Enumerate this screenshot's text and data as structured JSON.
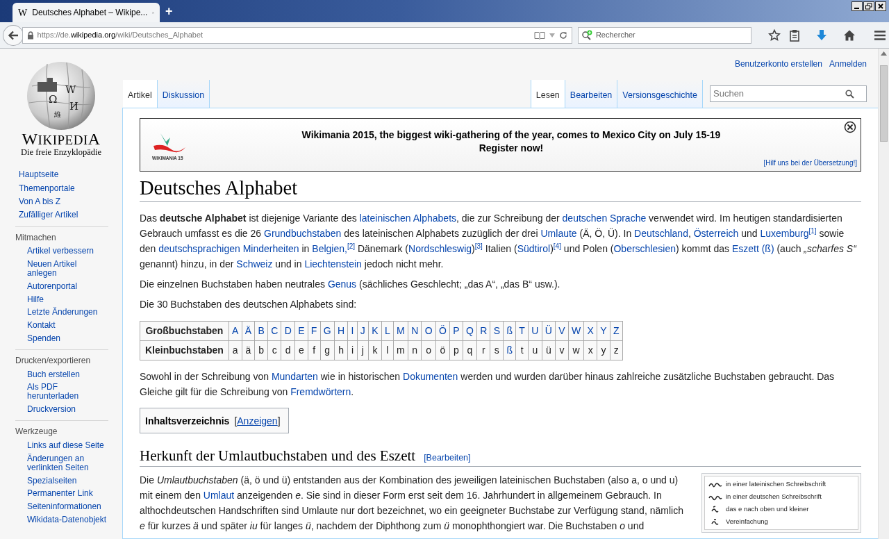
{
  "browser": {
    "favicon": "W",
    "tab_title": "Deutsches Alphabet – Wikipe...",
    "new_tab": "+",
    "url": {
      "prefix": "https://de.",
      "host": "wikipedia.org",
      "path": "/wiki/Deutsches_Alphabet"
    },
    "search_placeholder": "Rechercher"
  },
  "personal_links": [
    "Benutzerkonto erstellen",
    "Anmelden"
  ],
  "logo": {
    "glyphs": [
      "Ω",
      "W",
      "И",
      "維"
    ],
    "wordmark": "WIKIPEDIA",
    "tagline": "Die freie Enzyklopädie"
  },
  "sidebar": {
    "main": [
      "Hauptseite",
      "Themenportale",
      "Von A bis Z",
      "Zufälliger Artikel"
    ],
    "sections": [
      {
        "heading": "Mitmachen",
        "items": [
          "Artikel verbessern",
          "Neuen Artikel anlegen",
          "Autorenportal",
          "Hilfe",
          "Letzte Änderungen",
          "Kontakt",
          "Spenden"
        ]
      },
      {
        "heading": "Drucken/exportieren",
        "items": [
          "Buch erstellen",
          "Als PDF herunterladen",
          "Druckversion"
        ]
      },
      {
        "heading": "Werkzeuge",
        "items": [
          "Links auf diese Seite",
          "Änderungen an verlinkten Seiten",
          "Spezialseiten",
          "Permanenter Link",
          "Seiteninformationen",
          "Wikidata-Datenobjekt"
        ]
      }
    ]
  },
  "tabs_left": [
    {
      "label": "Artikel",
      "selected": true
    },
    {
      "label": "Diskussion",
      "selected": false
    }
  ],
  "tabs_right": [
    {
      "label": "Lesen",
      "selected": true
    },
    {
      "label": "Bearbeiten",
      "selected": false
    },
    {
      "label": "Versionsgeschichte",
      "selected": false
    }
  ],
  "search": {
    "placeholder": "Suchen"
  },
  "banner": {
    "logo_text": "WIKIMANIA 15",
    "lines": [
      "Wikimania 2015, the biggest wiki-gathering of the year, comes to Mexico City on July 15-19",
      "Register now!"
    ],
    "help_link": "[Hilf uns bei der Übersetzung!]"
  },
  "title": "Deutsches Alphabet",
  "intro": [
    [
      {
        "kind": "text",
        "text": "Das "
      },
      {
        "kind": "bold",
        "text": "deutsche Alphabet"
      },
      {
        "kind": "text",
        "text": " ist diejenige Variante des "
      },
      {
        "kind": "link",
        "text": "lateinischen Alphabets"
      },
      {
        "kind": "text",
        "text": ", die zur Schreibung der "
      },
      {
        "kind": "link",
        "text": "deutschen Sprache"
      },
      {
        "kind": "text",
        "text": " verwendet wird. Im heutigen standardisierten Gebrauch umfasst es die 26 "
      },
      {
        "kind": "link",
        "text": "Grundbuchstaben"
      },
      {
        "kind": "text",
        "text": " des lateinischen Alphabets zuzüglich der drei "
      },
      {
        "kind": "link",
        "text": "Umlaute"
      },
      {
        "kind": "text",
        "text": " (Ä, Ö, Ü). In "
      },
      {
        "kind": "link",
        "text": "Deutschland"
      },
      {
        "kind": "text",
        "text": ", "
      },
      {
        "kind": "link",
        "text": "Österreich"
      },
      {
        "kind": "text",
        "text": " und "
      },
      {
        "kind": "link",
        "text": "Luxemburg"
      },
      {
        "kind": "ref",
        "text": "[1]"
      },
      {
        "kind": "text",
        "text": " sowie den "
      },
      {
        "kind": "link",
        "text": "deutschsprachigen Minderheiten"
      },
      {
        "kind": "text",
        "text": " in "
      },
      {
        "kind": "link",
        "text": "Belgien,"
      },
      {
        "kind": "ref",
        "text": "[2]"
      },
      {
        "kind": "text",
        "text": " Dänemark ("
      },
      {
        "kind": "link",
        "text": "Nordschleswig"
      },
      {
        "kind": "text",
        "text": ")"
      },
      {
        "kind": "ref",
        "text": "[3]"
      },
      {
        "kind": "text",
        "text": " Italien ("
      },
      {
        "kind": "link",
        "text": "Südtirol"
      },
      {
        "kind": "text",
        "text": ")"
      },
      {
        "kind": "ref",
        "text": "[4]"
      },
      {
        "kind": "text",
        "text": " und Polen ("
      },
      {
        "kind": "link",
        "text": "Oberschlesien"
      },
      {
        "kind": "text",
        "text": ") kommt das "
      },
      {
        "kind": "link",
        "text": "Eszett (ß)"
      },
      {
        "kind": "text",
        "text": " (auch "
      },
      {
        "kind": "italic",
        "text": "„scharfes S“"
      },
      {
        "kind": "text",
        "text": " genannt) hinzu, in der "
      },
      {
        "kind": "link",
        "text": "Schweiz"
      },
      {
        "kind": "text",
        "text": " und in "
      },
      {
        "kind": "link",
        "text": "Liechtenstein"
      },
      {
        "kind": "text",
        "text": " jedoch nicht mehr."
      }
    ],
    [
      {
        "kind": "text",
        "text": "Die einzelnen Buchstaben haben neutrales "
      },
      {
        "kind": "link",
        "text": "Genus"
      },
      {
        "kind": "text",
        "text": " (sächliches Geschlecht; „das A“, „das B“ usw.)."
      }
    ],
    [
      {
        "kind": "text",
        "text": "Die 30 Buchstaben des deutschen Alphabets sind:"
      }
    ]
  ],
  "letter_table": [
    {
      "header": "Großbuchstaben",
      "cells": [
        {
          "text": "A",
          "link": true
        },
        {
          "text": "Ä",
          "link": true
        },
        {
          "text": "B",
          "link": true
        },
        {
          "text": "C",
          "link": true
        },
        {
          "text": "D",
          "link": true
        },
        {
          "text": "E",
          "link": true
        },
        {
          "text": "F",
          "link": true
        },
        {
          "text": "G",
          "link": true
        },
        {
          "text": "H",
          "link": true
        },
        {
          "text": "I",
          "link": true
        },
        {
          "text": "J",
          "link": true
        },
        {
          "text": "K",
          "link": true
        },
        {
          "text": "L",
          "link": true
        },
        {
          "text": "M",
          "link": true
        },
        {
          "text": "N",
          "link": true
        },
        {
          "text": "O",
          "link": true
        },
        {
          "text": "Ö",
          "link": true
        },
        {
          "text": "P",
          "link": true
        },
        {
          "text": "Q",
          "link": true
        },
        {
          "text": "R",
          "link": true
        },
        {
          "text": "S",
          "link": true
        },
        {
          "text": "ß",
          "link": true
        },
        {
          "text": "T",
          "link": true
        },
        {
          "text": "U",
          "link": true
        },
        {
          "text": "Ü",
          "link": true
        },
        {
          "text": "V",
          "link": true
        },
        {
          "text": "W",
          "link": true
        },
        {
          "text": "X",
          "link": true
        },
        {
          "text": "Y",
          "link": true
        },
        {
          "text": "Z",
          "link": true
        }
      ]
    },
    {
      "header": "Kleinbuchstaben",
      "cells": [
        {
          "text": "a",
          "link": false
        },
        {
          "text": "ä",
          "link": false
        },
        {
          "text": "b",
          "link": false
        },
        {
          "text": "c",
          "link": false
        },
        {
          "text": "d",
          "link": false
        },
        {
          "text": "e",
          "link": false
        },
        {
          "text": "f",
          "link": false
        },
        {
          "text": "g",
          "link": false
        },
        {
          "text": "h",
          "link": false
        },
        {
          "text": "i",
          "link": false
        },
        {
          "text": "j",
          "link": false
        },
        {
          "text": "k",
          "link": false
        },
        {
          "text": "l",
          "link": false
        },
        {
          "text": "m",
          "link": false
        },
        {
          "text": "n",
          "link": false
        },
        {
          "text": "o",
          "link": false
        },
        {
          "text": "ö",
          "link": false
        },
        {
          "text": "p",
          "link": false
        },
        {
          "text": "q",
          "link": false
        },
        {
          "text": "r",
          "link": false
        },
        {
          "text": "s",
          "link": false
        },
        {
          "text": "ß",
          "link": true
        },
        {
          "text": "t",
          "link": false
        },
        {
          "text": "u",
          "link": false
        },
        {
          "text": "ü",
          "link": false
        },
        {
          "text": "v",
          "link": false
        },
        {
          "text": "w",
          "link": false
        },
        {
          "text": "x",
          "link": false
        },
        {
          "text": "y",
          "link": false
        },
        {
          "text": "z",
          "link": false
        }
      ]
    }
  ],
  "after_table": [
    {
      "kind": "text",
      "text": "Sowohl in der Schreibung von "
    },
    {
      "kind": "link",
      "text": "Mundarten"
    },
    {
      "kind": "text",
      "text": " wie in historischen "
    },
    {
      "kind": "link",
      "text": "Dokumenten"
    },
    {
      "kind": "text",
      "text": " werden und wurden darüber hinaus zahlreiche zusätzliche Buchstaben gebraucht. Das Gleiche gilt für die Schreibung von "
    },
    {
      "kind": "link",
      "text": "Fremdwörtern"
    },
    {
      "kind": "text",
      "text": "."
    }
  ],
  "toc": {
    "title": "Inhaltsverzeichnis",
    "open_bracket": "[",
    "toggle": "Anzeigen",
    "close_bracket": "]"
  },
  "section": {
    "heading": "Herkunft der Umlautbuchstaben und des Eszett",
    "edit_link": "[Bearbeiten]",
    "figure": [
      "in einer lateinischen Schreibschrift",
      "in einer deutschen Schreibschrift",
      "das e nach oben und kleiner",
      "Vereinfachung"
    ],
    "paragraph": [
      {
        "kind": "text",
        "text": "Die "
      },
      {
        "kind": "italic",
        "text": "Umlautbuchstaben"
      },
      {
        "kind": "text",
        "text": " (ä, ö und ü) entstanden aus der Kombination des jeweiligen lateinischen Buchstaben (also a, o und u) mit einem den "
      },
      {
        "kind": "link",
        "text": "Umlaut"
      },
      {
        "kind": "text",
        "text": " anzeigenden "
      },
      {
        "kind": "italic",
        "text": "e"
      },
      {
        "kind": "text",
        "text": ". Sie sind in dieser Form erst seit dem 16. Jahrhundert in allgemeinem Gebrauch. In althochdeutschen Handschriften sind Umlaute nur dort bezeichnet, wo ein geeigneter Buchstabe zur Verfügung stand, nämlich "
      },
      {
        "kind": "italic",
        "text": "e"
      },
      {
        "kind": "text",
        "text": " für kurzes "
      },
      {
        "kind": "italic",
        "text": "ä"
      },
      {
        "kind": "text",
        "text": " und später "
      },
      {
        "kind": "italic",
        "text": "iu"
      },
      {
        "kind": "text",
        "text": " für langes "
      },
      {
        "kind": "italic",
        "text": "ü"
      },
      {
        "kind": "text",
        "text": ", nachdem der Diphthong zum "
      },
      {
        "kind": "italic",
        "text": "ü"
      },
      {
        "kind": "text",
        "text": " monophthongiert war. Die Buchstaben "
      },
      {
        "kind": "italic",
        "text": "o"
      },
      {
        "kind": "text",
        "text": " und"
      }
    ]
  }
}
